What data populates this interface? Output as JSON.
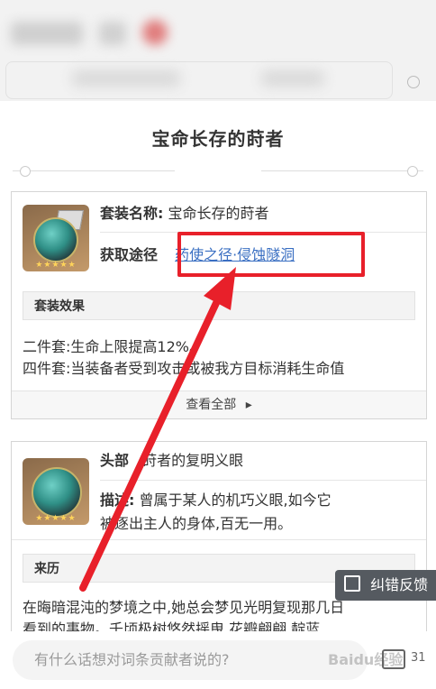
{
  "page": {
    "title": "宝命长存的莳者"
  },
  "set_card": {
    "name_label": "套装名称:",
    "name_value": "宝命长存的莳者",
    "source_label": "获取途径",
    "source_link": "药使之径·侵蚀隧洞",
    "effect_header": "套装效果",
    "effects": [
      "二件套:生命上限提高12%。",
      "四件套:当装备者受到攻击或被我方目标消耗生命值"
    ],
    "view_all": "查看全部",
    "view_all_arrow": "▸",
    "stars": "★★★★★"
  },
  "piece_card": {
    "slot_label": "头部",
    "slot_value": "莳者的复明义眼",
    "desc_label": "描述:",
    "desc_lines": [
      "曾属于某人的机巧义眼,如今它",
      "被逐出主人的身体,百无一用。"
    ],
    "lore_header": "来历",
    "lore_lines": [
      "在晦暗混沌的梦境之中,她总会梦见光明复现那几日",
      "看到的事物。千顷极树悠然摇曳,花瓣翩翩,靛蓝"
    ],
    "stars": "★★★★★"
  },
  "feedback_button": {
    "label": "纠错反馈"
  },
  "comment": {
    "placeholder": "有什么话想对词条贡献者说的?",
    "count": "31"
  },
  "watermark": "Baidu经验",
  "colors": {
    "highlight": "#e8202a",
    "link": "#3a6fc2",
    "accent_arrow": "#e8202a"
  }
}
